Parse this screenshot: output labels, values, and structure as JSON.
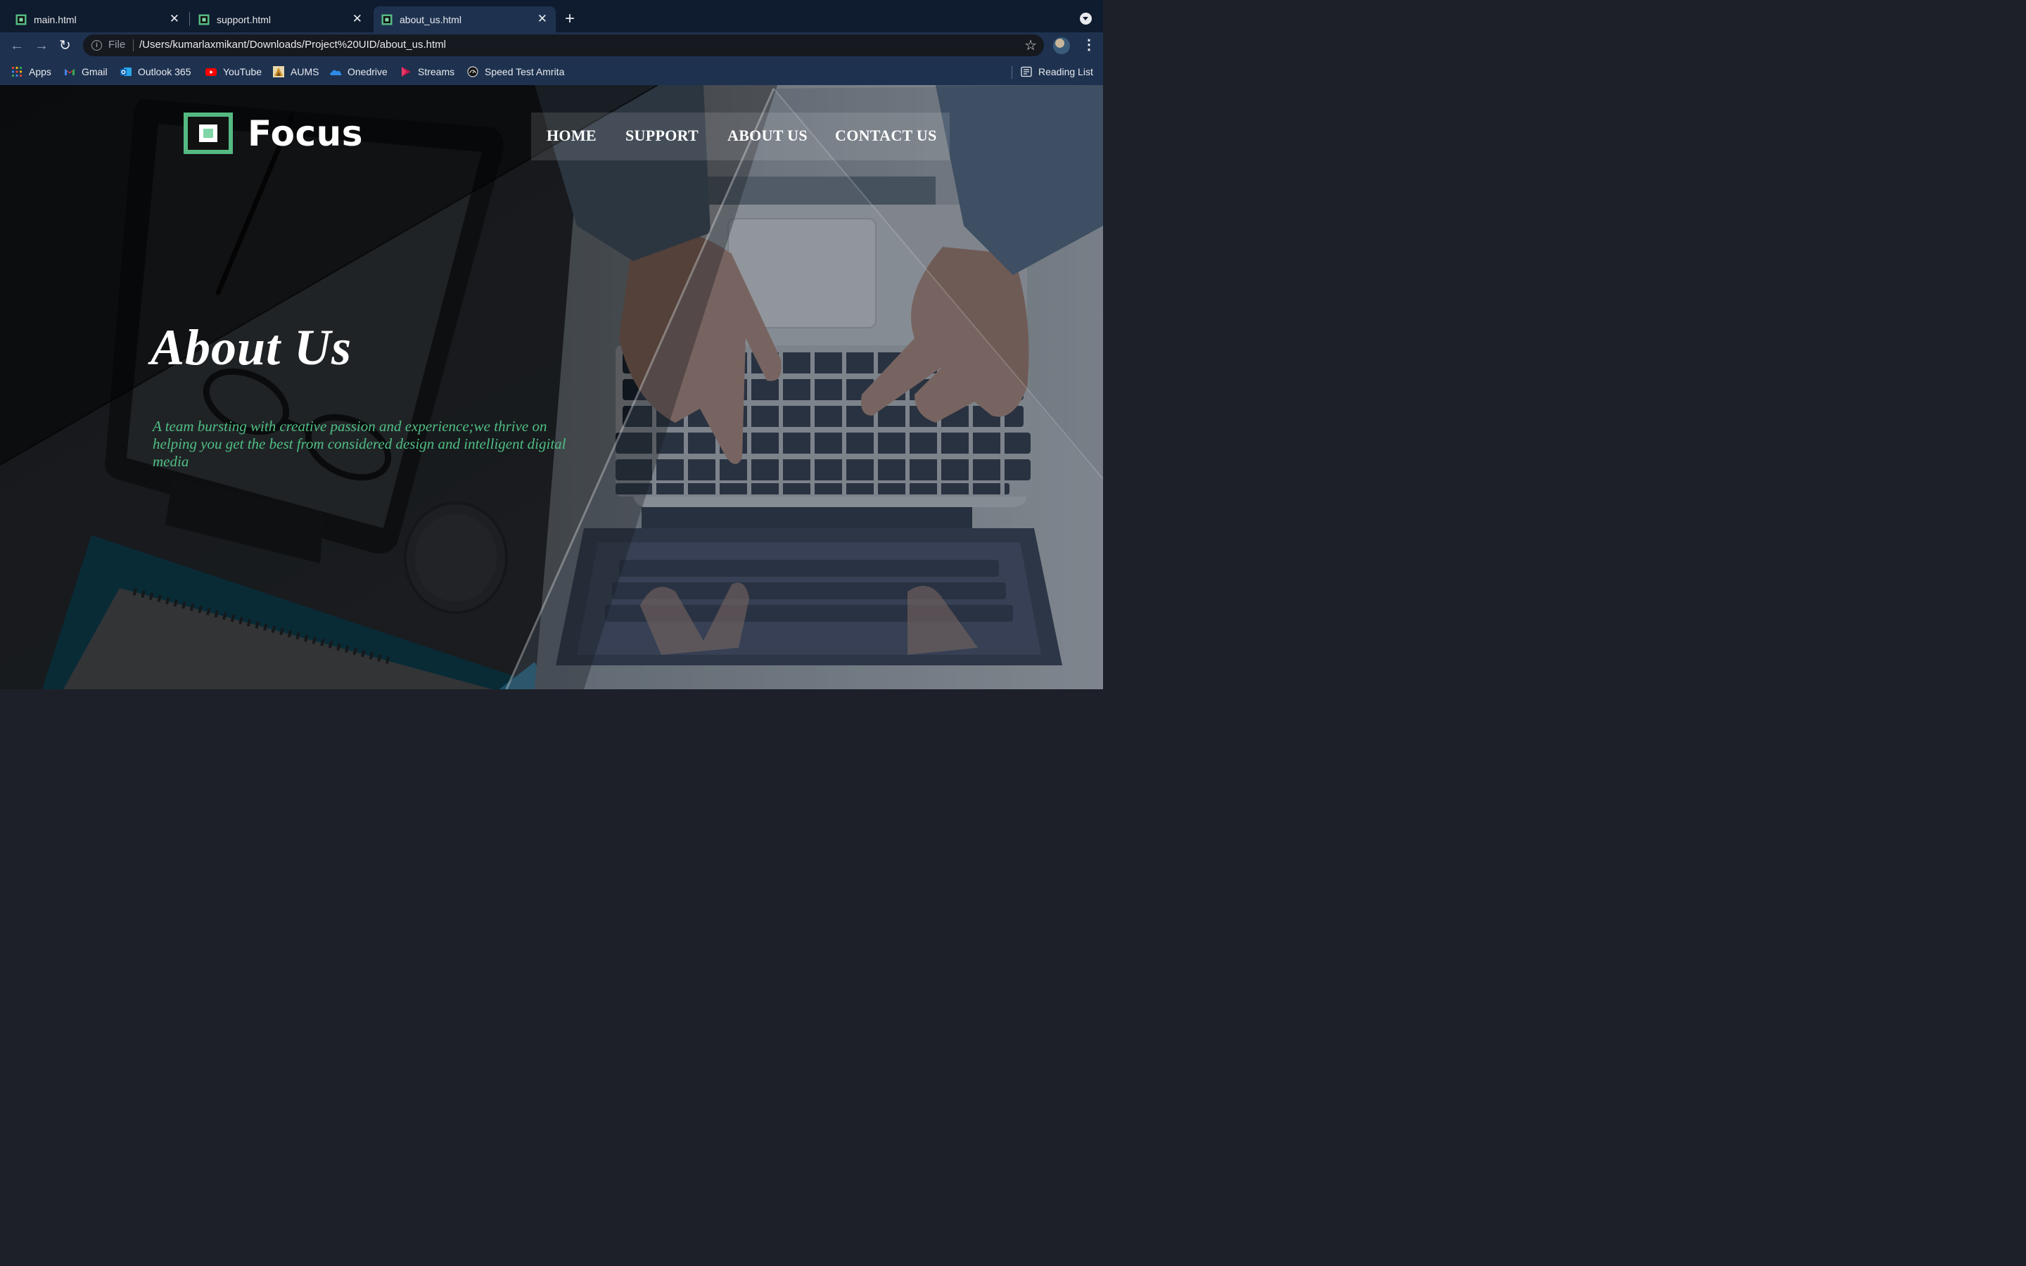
{
  "browser": {
    "tabs": [
      {
        "title": "main.html",
        "active": false
      },
      {
        "title": "support.html",
        "active": false
      },
      {
        "title": "about_us.html",
        "active": true
      }
    ],
    "address_bar": {
      "scheme_label": "File",
      "url": "/Users/kumarlaxmikant/Downloads/Project%20UID/about_us.html"
    },
    "bookmarks": [
      {
        "label": "Apps",
        "icon": "apps-grid-icon"
      },
      {
        "label": "Gmail",
        "icon": "gmail-icon"
      },
      {
        "label": "Outlook 365",
        "icon": "outlook-icon"
      },
      {
        "label": "YouTube",
        "icon": "youtube-icon"
      },
      {
        "label": "AUMS",
        "icon": "aums-icon"
      },
      {
        "label": "Onedrive",
        "icon": "onedrive-icon"
      },
      {
        "label": "Streams",
        "icon": "streams-icon"
      },
      {
        "label": "Speed Test Amrita",
        "icon": "speedtest-icon"
      }
    ],
    "reading_list_label": "Reading List",
    "colors": {
      "frame": "#0f1b2e",
      "toolbar": "#1e3250",
      "omnibox": "#16191f"
    }
  },
  "site": {
    "brand_name": "Focus",
    "nav": [
      {
        "label": "HOME"
      },
      {
        "label": "SUPPORT"
      },
      {
        "label": "ABOUT US"
      },
      {
        "label": "CONTACT US"
      }
    ],
    "hero": {
      "title": "About Us",
      "tagline": "A team bursting with creative passion and experience;we thrive on helping you get the best from considered design and intelligent digital media"
    },
    "colors": {
      "accent_green": "#4fbf84",
      "logo_green": "#55b982"
    }
  }
}
